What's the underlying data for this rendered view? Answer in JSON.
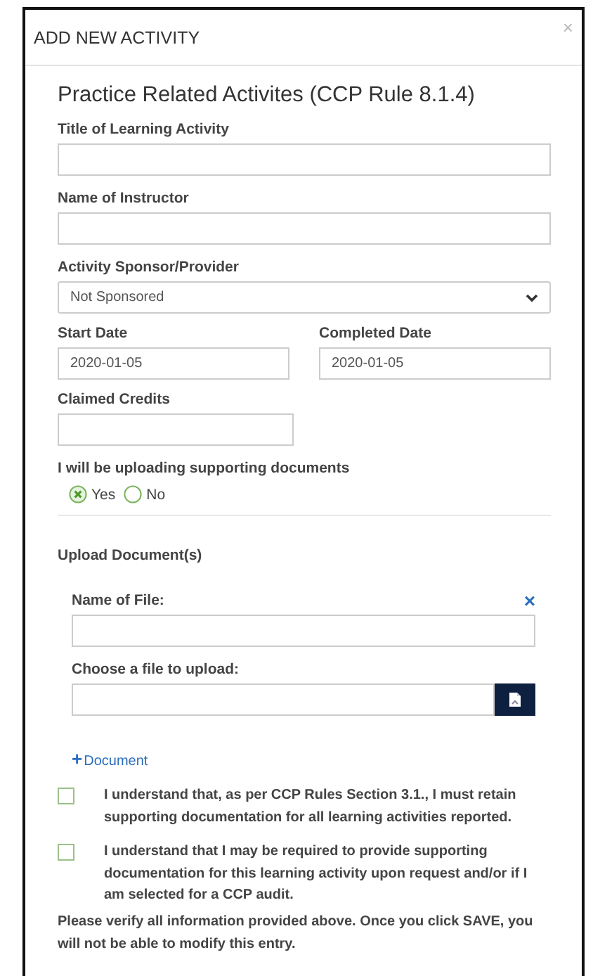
{
  "modal": {
    "title": "ADD NEW ACTIVITY",
    "close": "×"
  },
  "heading": "Practice Related Activites (CCP Rule 8.1.4)",
  "fields": {
    "title_label": "Title of Learning Activity",
    "instructor_label": "Name of Instructor",
    "sponsor_label": "Activity Sponsor/Provider",
    "sponsor_value": "Not Sponsored",
    "start_label": "Start Date",
    "start_value": "2020-01-05",
    "completed_label": "Completed Date",
    "completed_value": "2020-01-05",
    "credits_label": "Claimed Credits"
  },
  "uploading": {
    "question": "I will be uploading supporting documents",
    "options": [
      {
        "label": "Yes",
        "selected": true
      },
      {
        "label": "No",
        "selected": false
      }
    ]
  },
  "upload": {
    "heading": "Upload Document(s)",
    "file_name_label": "Name of File:",
    "remove": "×",
    "choose_label": "Choose a file to upload:",
    "add_plus": "+",
    "add_label": "Document"
  },
  "acknowledgements": [
    {
      "text": "I understand that, as per CCP Rules Section 3.1., I must retain supporting documentation for all learning activities reported.",
      "checked": false
    },
    {
      "text": "I understand that I may be required to provide supporting documentation for this learning activity upon request and/or if I am selected for a CCP audit.",
      "checked": false
    }
  ],
  "notice": "Please verify all information provided above. Once you click SAVE, you will not be able to modify this entry."
}
